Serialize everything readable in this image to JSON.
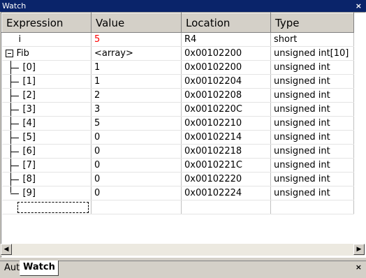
{
  "window": {
    "title": "Watch",
    "close_glyph": "×"
  },
  "columns": [
    "Expression",
    "Value",
    "Location",
    "Type"
  ],
  "rows": [
    {
      "expr": "i",
      "value": "5",
      "location": "R4",
      "type": "short",
      "kind": "plain",
      "changed": true
    },
    {
      "expr": "Fib",
      "value": "<array>",
      "location": "0x00102200",
      "type": "unsigned int[10]",
      "kind": "expanded"
    },
    {
      "expr": "[0]",
      "value": "1",
      "location": "0x00102200",
      "type": "unsigned int",
      "kind": "child"
    },
    {
      "expr": "[1]",
      "value": "1",
      "location": "0x00102204",
      "type": "unsigned int",
      "kind": "child"
    },
    {
      "expr": "[2]",
      "value": "2",
      "location": "0x00102208",
      "type": "unsigned int",
      "kind": "child"
    },
    {
      "expr": "[3]",
      "value": "3",
      "location": "0x0010220C",
      "type": "unsigned int",
      "kind": "child"
    },
    {
      "expr": "[4]",
      "value": "5",
      "location": "0x00102210",
      "type": "unsigned int",
      "kind": "child"
    },
    {
      "expr": "[5]",
      "value": "0",
      "location": "0x00102214",
      "type": "unsigned int",
      "kind": "child"
    },
    {
      "expr": "[6]",
      "value": "0",
      "location": "0x00102218",
      "type": "unsigned int",
      "kind": "child"
    },
    {
      "expr": "[7]",
      "value": "0",
      "location": "0x0010221C",
      "type": "unsigned int",
      "kind": "child"
    },
    {
      "expr": "[8]",
      "value": "0",
      "location": "0x00102220",
      "type": "unsigned int",
      "kind": "child"
    },
    {
      "expr": "[9]",
      "value": "0",
      "location": "0x00102224",
      "type": "unsigned int",
      "kind": "last-child"
    }
  ],
  "scrollbar": {
    "left_arrow": "◀",
    "right_arrow": "▶"
  },
  "tabs": [
    {
      "label": "Auto",
      "active": false
    },
    {
      "label": "Watch",
      "active": true
    }
  ],
  "colors": {
    "title_bg": "#0a246a",
    "changed_value": "#ff0000",
    "chrome": "#d4d0c8"
  }
}
